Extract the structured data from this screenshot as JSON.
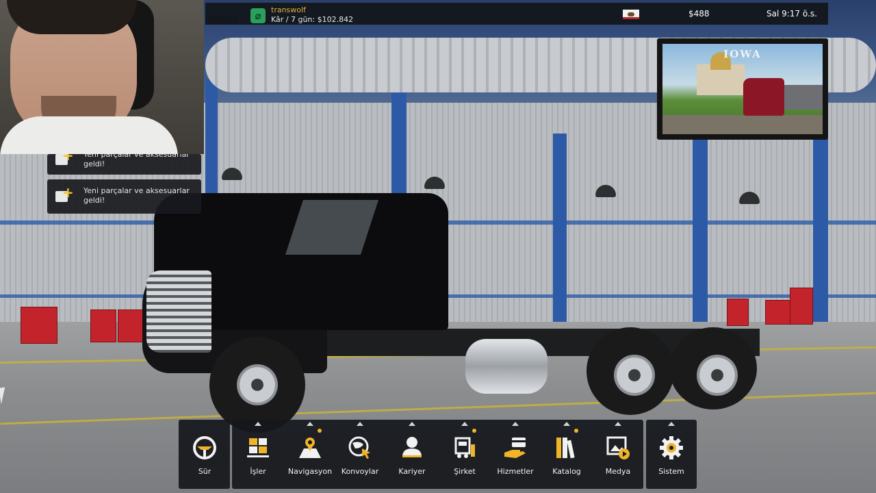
{
  "topbar": {
    "company_name": "transwolf",
    "profit_text": "Kâr / 7 gün: $102.842",
    "money": "$488",
    "clock": "Sal 9:17 ö.s.",
    "company_logo_icon": "slashed-circle-logo",
    "state_flag_icon": "california-flag-icon"
  },
  "notifications": [
    {
      "text": "Yeni parçalar ve aksesuarlar geldi!",
      "icon": "truck-parts-plus-icon"
    },
    {
      "text": "Yeni parçalar ve aksesuarlar geldi!",
      "icon": "truck-parts-plus-icon"
    }
  ],
  "promo": {
    "title": "IOWA"
  },
  "dock": {
    "drive": {
      "label": "Sür",
      "icon": "steering-wheel-icon"
    },
    "items": [
      {
        "label": "İşler",
        "icon": "cargo-boxes-icon",
        "has_dot": false
      },
      {
        "label": "Navigasyon",
        "icon": "map-pin-icon",
        "has_dot": true
      },
      {
        "label": "Konvoylar",
        "icon": "globe-cursor-icon",
        "has_dot": false
      },
      {
        "label": "Kariyer",
        "icon": "person-icon",
        "has_dot": false
      },
      {
        "label": "Şirket",
        "icon": "company-truck-icon",
        "has_dot": true
      },
      {
        "label": "Hizmetler",
        "icon": "hand-card-icon",
        "has_dot": false
      },
      {
        "label": "Katalog",
        "icon": "books-icon",
        "has_dot": true
      },
      {
        "label": "Medya",
        "icon": "media-play-icon",
        "has_dot": false
      }
    ],
    "system": {
      "label": "Sistem",
      "icon": "gear-icon"
    }
  },
  "colors": {
    "accent_yellow": "#f0b428",
    "company_green": "#2aa05c",
    "panel_bg": "#16181c"
  }
}
